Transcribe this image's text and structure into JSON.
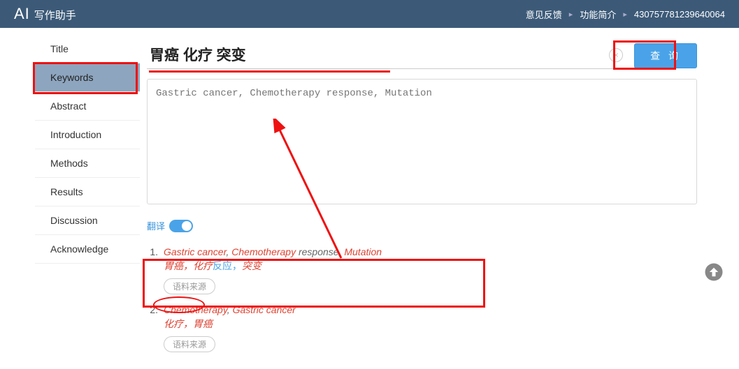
{
  "topbar": {
    "logo_ai": "AI",
    "logo_text": "写作助手",
    "feedback": "意见反馈",
    "features": "功能简介",
    "user_id": "430757781239640064"
  },
  "sidebar": {
    "items": [
      {
        "label": "Title",
        "active": false
      },
      {
        "label": "Keywords",
        "active": true
      },
      {
        "label": "Abstract",
        "active": false
      },
      {
        "label": "Introduction",
        "active": false
      },
      {
        "label": "Methods",
        "active": false
      },
      {
        "label": "Results",
        "active": false
      },
      {
        "label": "Discussion",
        "active": false
      },
      {
        "label": "Acknowledge",
        "active": false
      }
    ]
  },
  "search": {
    "value": "胃癌 化疗 突变",
    "clear_icon": "×",
    "button": "查 询"
  },
  "textarea": {
    "placeholder": "Gastric cancer, Chemotherapy response, Mutation"
  },
  "translate": {
    "label": "翻译",
    "on": true
  },
  "results": [
    {
      "num": "1.",
      "en_parts": [
        {
          "t": "Gastric cancer",
          "c": "red"
        },
        {
          "t": ", ",
          "c": "gray"
        },
        {
          "t": "Chemotherapy",
          "c": "red"
        },
        {
          "t": " response, ",
          "c": "gray"
        },
        {
          "t": "Mutation",
          "c": "red"
        }
      ],
      "zh_parts": [
        {
          "t": "胃癌",
          "c": "red"
        },
        {
          "t": "，",
          "c": "red"
        },
        {
          "t": "化疗",
          "c": "red"
        },
        {
          "t": "反应，",
          "c": "blue"
        },
        {
          "t": "突变",
          "c": "red"
        }
      ],
      "source": "语料来源"
    },
    {
      "num": "2.",
      "en_parts": [
        {
          "t": "Chemotherapy",
          "c": "red"
        },
        {
          "t": ", ",
          "c": "gray"
        },
        {
          "t": "Gastric cancer",
          "c": "red"
        }
      ],
      "zh_parts": [
        {
          "t": "化疗",
          "c": "red"
        },
        {
          "t": "，",
          "c": "red"
        },
        {
          "t": "胃癌",
          "c": "red"
        }
      ],
      "source": "语料来源"
    }
  ],
  "icons": {
    "scrolltop": "⬆"
  }
}
